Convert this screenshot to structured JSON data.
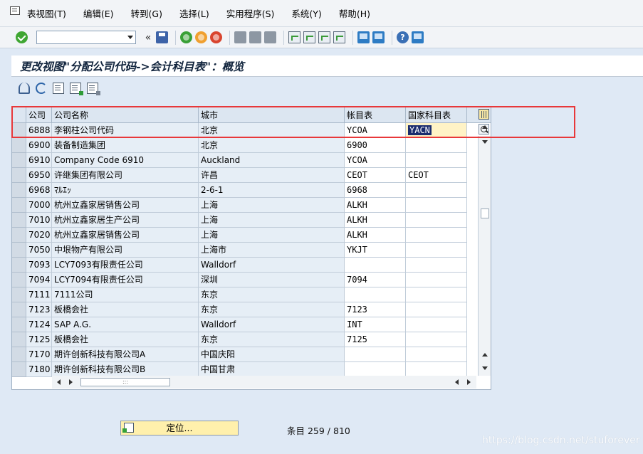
{
  "menu": {
    "items": [
      "表视图(T)",
      "编辑(E)",
      "转到(G)",
      "选择(L)",
      "实用程序(S)",
      "系统(Y)",
      "帮助(H)"
    ]
  },
  "toolbar": {
    "command_value": "",
    "back_glyph": "«"
  },
  "header": {
    "title": "更改视图\"分配公司代码->会计科目表\"：概览"
  },
  "table": {
    "columns": [
      "公司",
      "公司名称",
      "城市",
      "帐目表",
      "国家科目表"
    ],
    "rows": [
      [
        "6888",
        "李钢柱公司代码",
        "北京",
        "YCOA",
        "YACN"
      ],
      [
        "6900",
        "装备制造集团",
        "北京",
        "6900",
        ""
      ],
      [
        "6910",
        "Company Code 6910",
        "Auckland",
        "YCOA",
        ""
      ],
      [
        "6950",
        "许继集团有限公司",
        "许昌",
        "CEOT",
        "CEOT"
      ],
      [
        "6968",
        "ﾏﾙｴｯ",
        "2-6-1",
        "6968",
        ""
      ],
      [
        "7000",
        "杭州立鑫家居销售公司",
        "上海",
        "ALKH",
        ""
      ],
      [
        "7010",
        "杭州立鑫家居生产公司",
        "上海",
        "ALKH",
        ""
      ],
      [
        "7020",
        "杭州立鑫家居销售公司",
        "上海",
        "ALKH",
        ""
      ],
      [
        "7050",
        "中垠物产有限公司",
        "上海市",
        "YKJT",
        ""
      ],
      [
        "7093",
        "LCY7093有限责任公司",
        "Walldorf",
        "",
        ""
      ],
      [
        "7094",
        "LCY7094有限责任公司",
        "深圳",
        "7094",
        ""
      ],
      [
        "7111",
        "7111公司",
        "东京",
        "",
        ""
      ],
      [
        "7123",
        "板橋会社",
        "东京",
        "7123",
        ""
      ],
      [
        "7124",
        "SAP A.G.",
        "Walldorf",
        "INT",
        ""
      ],
      [
        "7125",
        "板橋会社",
        "东京",
        "7125",
        ""
      ],
      [
        "7170",
        "期许创新科技有限公司A",
        "中国庆阳",
        "",
        ""
      ],
      [
        "7180",
        "期许创新科技有限公司B",
        "中国甘肃",
        "",
        ""
      ]
    ]
  },
  "footer": {
    "position_button": "定位...",
    "entry_count": "条目 259 / 810",
    "watermark": "https://blog.csdn.net/stuforever"
  },
  "colors": {
    "highlight_border": "#e8383a",
    "focus_field": "#fff3c6",
    "selection": "#1b2c6e"
  }
}
